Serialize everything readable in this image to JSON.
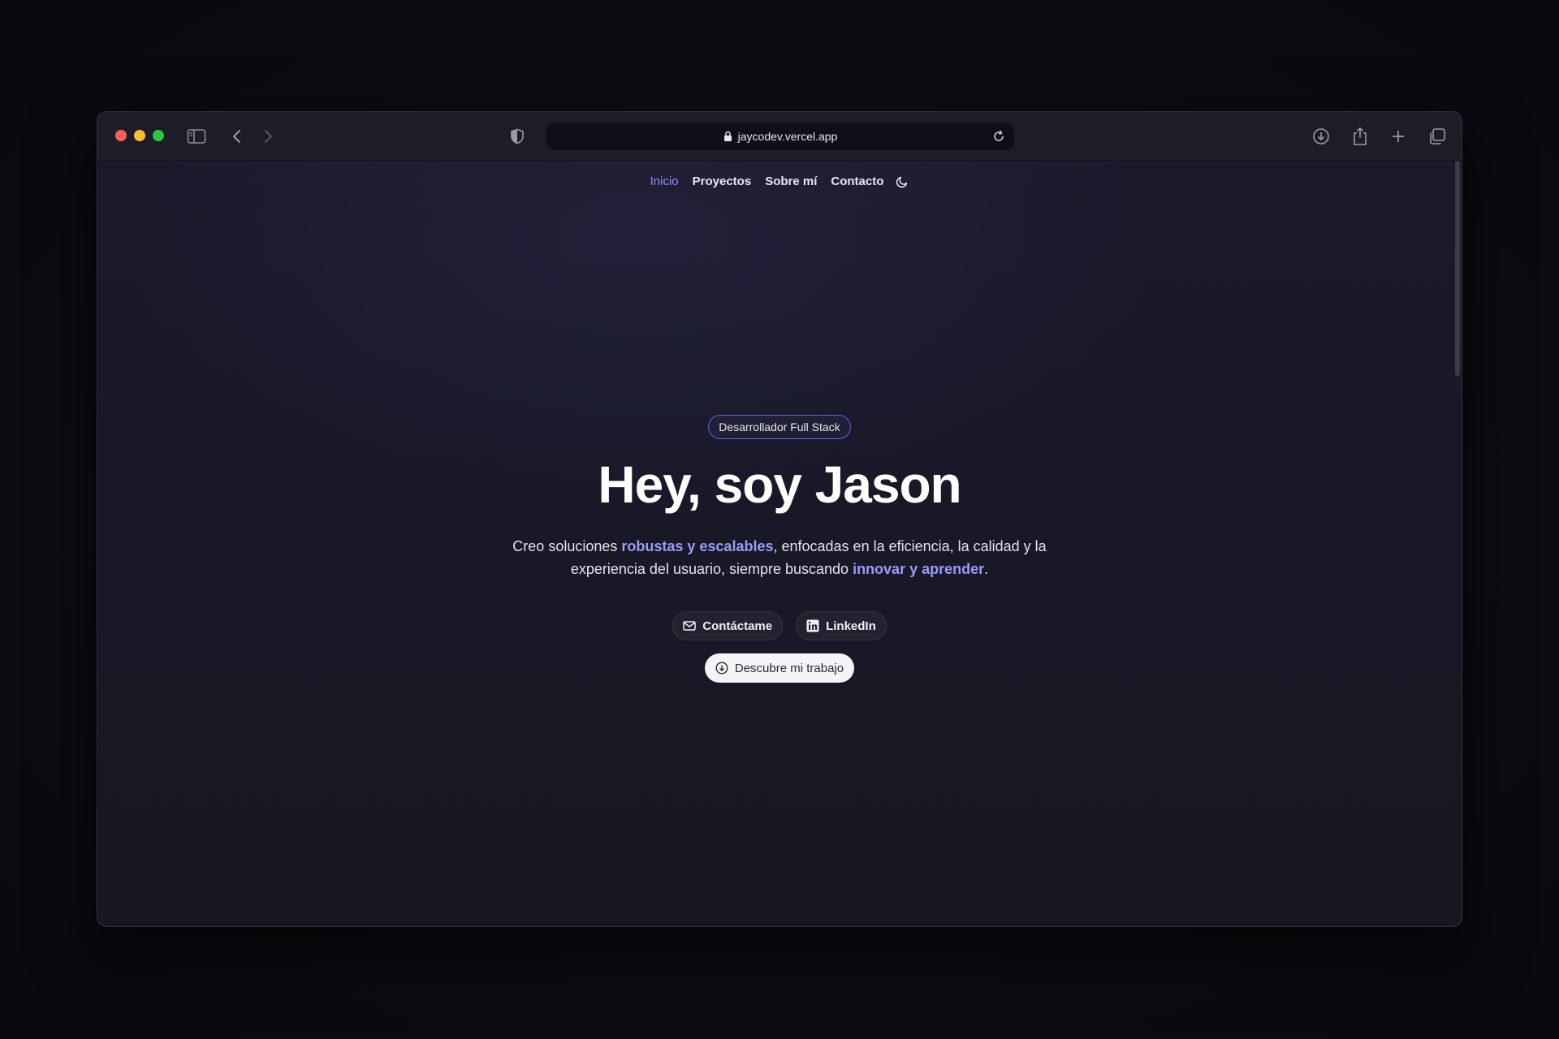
{
  "browser": {
    "url": "jaycodev.vercel.app"
  },
  "nav": {
    "items": [
      {
        "label": "Inicio",
        "active": true
      },
      {
        "label": "Proyectos",
        "active": false
      },
      {
        "label": "Sobre mí",
        "active": false
      },
      {
        "label": "Contacto",
        "active": false
      }
    ],
    "theme_toggle_icon": "moon-icon"
  },
  "hero": {
    "badge": "Desarrollador Full Stack",
    "title": "Hey, soy Jason",
    "description": {
      "part1": "Creo soluciones ",
      "highlight1": "robustas y escalables",
      "part2": ", enfocadas en la eficiencia, la calidad y la experiencia del usuario, siempre buscando ",
      "highlight2": "innovar y aprender",
      "part3": "."
    },
    "buttons": {
      "contact": "Contáctame",
      "linkedin": "LinkedIn",
      "discover": "Descubre mi trabajo"
    }
  },
  "colors": {
    "accent": "#8d8ff5",
    "highlight": "#9a9cf7",
    "badge_border": "#5f63d8",
    "background": "#181827"
  }
}
